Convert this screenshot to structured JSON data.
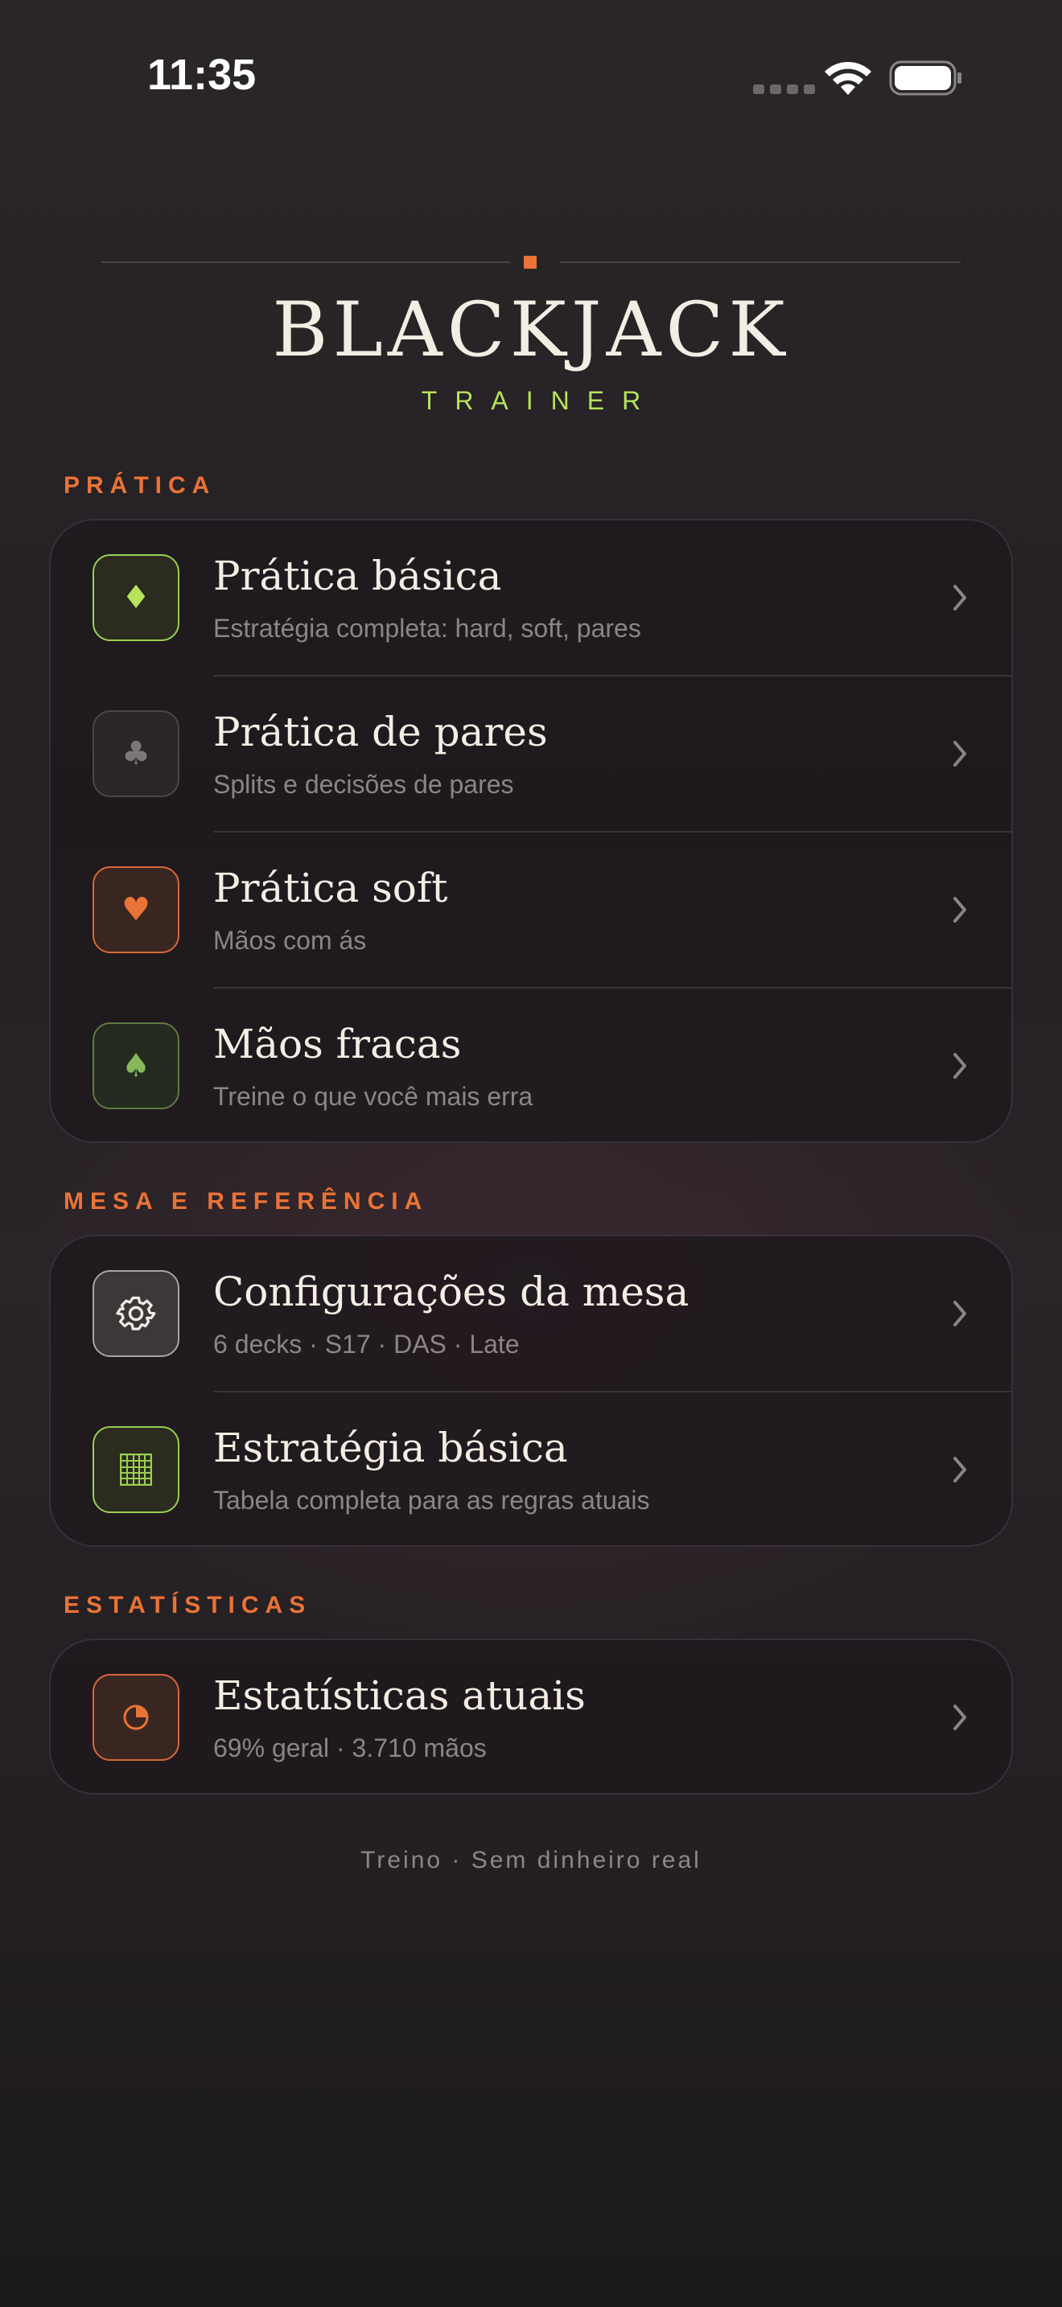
{
  "status_bar": {
    "time": "11:35"
  },
  "header": {
    "title": "BLACKJACK",
    "subtitle": "TRAINER"
  },
  "sections": [
    {
      "label": "PRÁTICA",
      "items": [
        {
          "title": "Prática básica",
          "subtitle": "Estratégia completa: hard, soft, pares",
          "icon": "diamond-icon",
          "glyph": "♦"
        },
        {
          "title": "Prática de pares",
          "subtitle": "Splits e decisões de pares",
          "icon": "club-icon",
          "glyph": "♣"
        },
        {
          "title": "Prática soft",
          "subtitle": "Mãos com ás",
          "icon": "heart-icon",
          "glyph": "♥"
        },
        {
          "title": "Mãos fracas",
          "subtitle": "Treine o que você mais erra",
          "icon": "spade-icon",
          "glyph": "♠"
        }
      ]
    },
    {
      "label": "MESA E REFERÊNCIA",
      "items": [
        {
          "title": "Configurações da mesa",
          "subtitle": "6 decks · S17 · DAS · Late",
          "icon": "gear-icon",
          "glyph": "⚙"
        },
        {
          "title": "Estratégia básica",
          "subtitle": "Tabela completa para as regras atuais",
          "icon": "grid-icon",
          "glyph": "▦"
        }
      ]
    },
    {
      "label": "ESTATÍSTICAS",
      "items": [
        {
          "title": "Estatísticas atuais",
          "subtitle": "69% geral · 3.710 mãos",
          "icon": "pie-chart-icon",
          "glyph": "◔"
        }
      ]
    }
  ],
  "footer": {
    "note": "Treino · Sem dinheiro real"
  },
  "colors": {
    "accent_orange": "#ea7336",
    "accent_green": "#b6e35c",
    "background": "#252124"
  }
}
